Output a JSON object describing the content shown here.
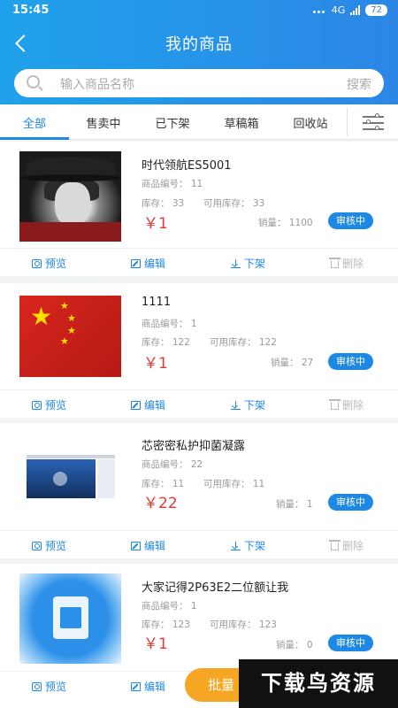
{
  "status_bar": {
    "time": "15:45",
    "network": "4G",
    "battery": "72"
  },
  "header": {
    "title": "我的商品"
  },
  "search": {
    "placeholder": "输入商品名称",
    "button_label": "搜索"
  },
  "tabs": [
    {
      "label": "全部",
      "active": true
    },
    {
      "label": "售卖中",
      "active": false
    },
    {
      "label": "已下架",
      "active": false
    },
    {
      "label": "草稿箱",
      "active": false
    },
    {
      "label": "回收站",
      "active": false
    }
  ],
  "actions": {
    "preview": "预览",
    "edit": "编辑",
    "offshelf": "下架",
    "delete": "删除"
  },
  "products": [
    {
      "name": "时代领航ES5001",
      "code_label": "商品编号：",
      "code": "11",
      "stock_label": "库存：",
      "stock": "33",
      "avail_label": "可用库存：",
      "avail": "33",
      "price": "￥1",
      "sales_label": "销量：",
      "sales": "1100",
      "status": "审核中",
      "thumb": "avatar-image"
    },
    {
      "name": "1111",
      "code_label": "商品编号：",
      "code": "1",
      "stock_label": "库存：",
      "stock": "122",
      "avail_label": "可用库存：",
      "avail": "122",
      "price": "￥1",
      "sales_label": "销量：",
      "sales": "27",
      "status": "审核中",
      "thumb": "flag-image"
    },
    {
      "name": "芯密密私护抑菌凝露",
      "code_label": "商品编号：",
      "code": "22",
      "stock_label": "库存：",
      "stock": "11",
      "avail_label": "可用库存：",
      "avail": "11",
      "price": "￥22",
      "sales_label": "销量：",
      "sales": "1",
      "status": "审核中",
      "thumb": "screenshot-image"
    },
    {
      "name": "大家记得2P63E2二位额让我",
      "code_label": "商品编号：",
      "code": "1",
      "stock_label": "库存：",
      "stock": "123",
      "avail_label": "可用库存：",
      "avail": "123",
      "price": "￥1",
      "sales_label": "销量：",
      "sales": "0",
      "status": "审核中",
      "thumb": "app-icon-image"
    }
  ],
  "batch_button": {
    "label": "批量"
  },
  "watermark": {
    "text": "下载鸟资源"
  },
  "colors": {
    "accent": "#1e88e5",
    "price": "#e53935",
    "batch": "#f5a623"
  }
}
